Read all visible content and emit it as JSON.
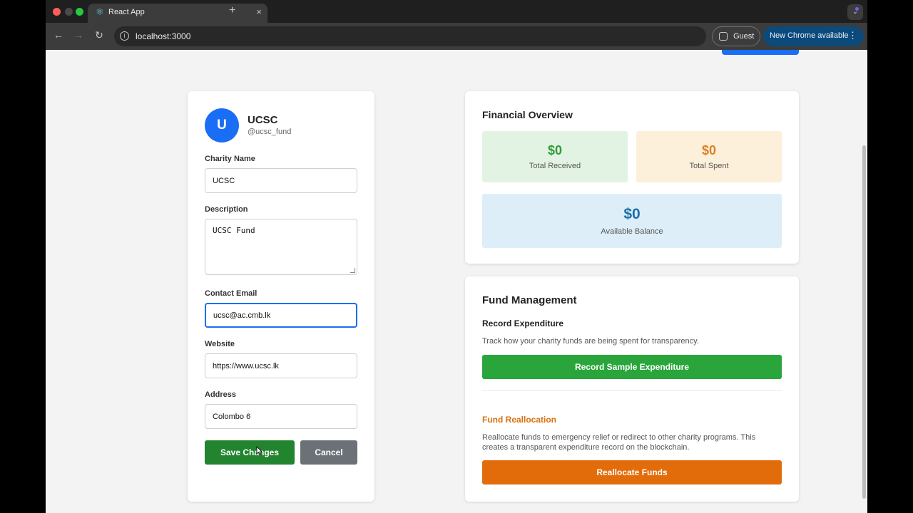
{
  "browser": {
    "tab_title": "React App",
    "url": "localhost:3000",
    "guest_label": "Guest",
    "update_label": "New Chrome available",
    "new_tab_symbol": "+",
    "tab_close_symbol": "×"
  },
  "profile": {
    "avatar_letter": "U",
    "name": "UCSC",
    "handle": "@ucsc_fund",
    "fields": {
      "charity_name": {
        "label": "Charity Name",
        "value": "UCSC"
      },
      "description": {
        "label": "Description",
        "value": "UCSC Fund"
      },
      "contact_email": {
        "label": "Contact Email",
        "value": "ucsc@ac.cmb.lk"
      },
      "website": {
        "label": "Website",
        "value": "https://www.ucsc.lk"
      },
      "address": {
        "label": "Address",
        "value": "Colombo 6"
      }
    },
    "save_label": "Save Changes",
    "cancel_label": "Cancel"
  },
  "overview": {
    "title": "Financial Overview",
    "total_received": {
      "value": "$0",
      "label": "Total Received",
      "color": "#2e9e3a"
    },
    "total_spent": {
      "value": "$0",
      "label": "Total Spent",
      "color": "#d9822b"
    },
    "available_balance": {
      "value": "$0",
      "label": "Available Balance",
      "color": "#1f6fa8"
    }
  },
  "fund_management": {
    "title": "Fund Management",
    "record": {
      "title": "Record Expenditure",
      "description": "Track how your charity funds are being spent for transparency.",
      "button_label": "Record Sample Expenditure"
    },
    "reallocation": {
      "title": "Fund Reallocation",
      "title_color": "#d9720f",
      "description": "Reallocate funds to emergency relief or redirect to other charity programs. This creates a transparent expenditure record on the blockchain.",
      "button_label": "Reallocate Funds"
    }
  }
}
